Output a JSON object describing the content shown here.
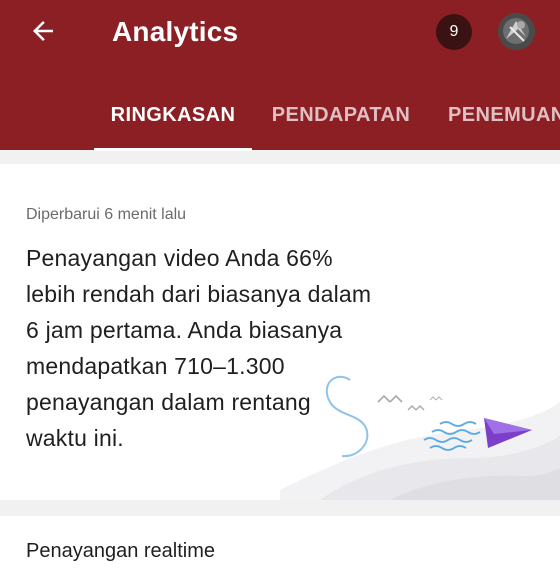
{
  "header": {
    "title": "Analytics",
    "notification_count": "9",
    "accent_color": "#8b1f24"
  },
  "icons": {
    "back": "back-arrow-icon",
    "avatar": "user-avatar"
  },
  "tabs": [
    {
      "label": "RINGKASAN",
      "active": true
    },
    {
      "label": "PENDAPATAN",
      "active": false
    },
    {
      "label": "PENEMUAN",
      "active": false
    }
  ],
  "summary_card": {
    "updated_text": "Diperbarui 6 menit lalu",
    "insight_lines": [
      "Penayangan video Anda 66%",
      "lebih rendah dari biasanya dalam",
      "6 jam pertama. Anda biasanya",
      "mendapatkan 710–1.300",
      "penayangan dalam rentang",
      "waktu ini."
    ]
  },
  "realtime_card": {
    "title": "Penayangan realtime"
  }
}
